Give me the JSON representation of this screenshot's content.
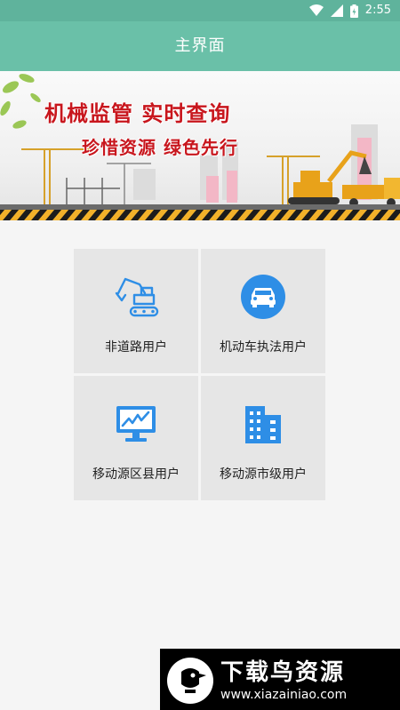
{
  "status_bar": {
    "time": "2:55",
    "icons": [
      "wifi-icon",
      "signal-icon",
      "battery-icon"
    ]
  },
  "app_bar": {
    "title": "主界面"
  },
  "banner": {
    "line1": "机械监管  实时查询",
    "line2": "珍惜资源  绿色先行"
  },
  "menu": {
    "items": [
      {
        "label": "非道路用户",
        "icon": "excavator-icon"
      },
      {
        "label": "机动车执法用户",
        "icon": "car-icon"
      },
      {
        "label": "移动源区县用户",
        "icon": "monitor-chart-icon"
      },
      {
        "label": "移动源市级用户",
        "icon": "building-icon"
      }
    ]
  },
  "watermark": {
    "title": "下载鸟资源",
    "url": "www.xiazainiao.com"
  },
  "colors": {
    "status_bar": "#5fb39c",
    "app_bar": "#6ac0a8",
    "icon_blue": "#2e8ee6",
    "tile_bg": "#e6e6e6",
    "banner_text": "#c8161d"
  }
}
